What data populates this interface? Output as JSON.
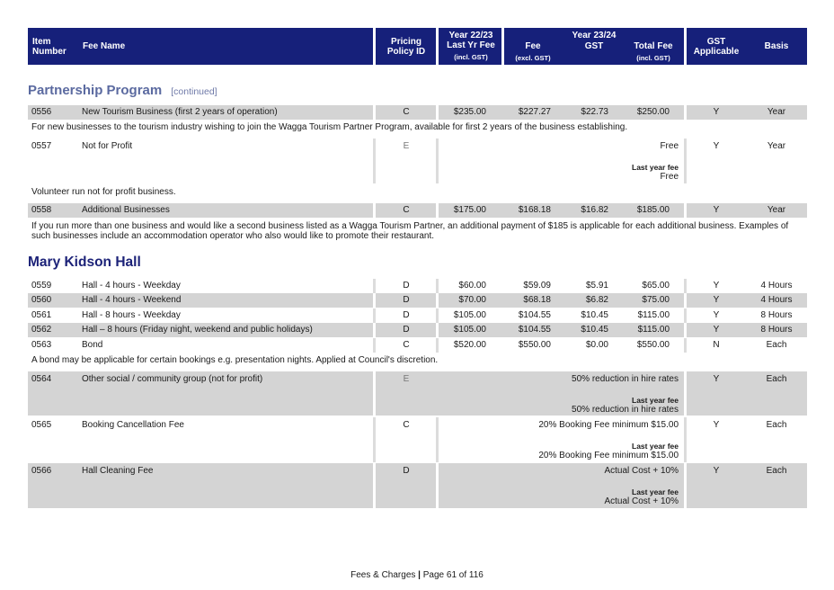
{
  "header": {
    "item_number": "Item Number",
    "fee_name": "Fee Name",
    "pricing_policy": "Pricing Policy ID",
    "year_prev_top": "Year 22/23",
    "year_prev_mid": "Last Yr Fee",
    "year_prev_small": "(incl. GST)",
    "year_curr": "Year 23/24",
    "fee": "Fee",
    "fee_small": "(excl. GST)",
    "gst": "GST",
    "total_fee": "Total Fee",
    "total_small": "(incl. GST)",
    "gst_applicable": "GST Applicable",
    "basis": "Basis"
  },
  "sections": {
    "partnership": {
      "title": "Partnership Program",
      "note": "[continued]"
    },
    "hall": {
      "title": "Mary Kidson Hall"
    }
  },
  "rows": {
    "r0556": {
      "item": "0556",
      "name": "New Tourism Business (first 2 years of operation)",
      "policy": "C",
      "last": "$235.00",
      "fee": "$227.27",
      "gst": "$22.73",
      "total": "$250.00",
      "gst_app": "Y",
      "basis": "Year",
      "desc": "For new businesses to the tourism industry wishing to join the Wagga Tourism Partner Program, available for first 2 years of the business establishing."
    },
    "r0557": {
      "item": "0557",
      "name": "Not for Profit",
      "policy": "E",
      "value": "Free",
      "last_label": "Last year fee",
      "last_value": "Free",
      "gst_app": "Y",
      "basis": "Year",
      "desc": "Volunteer run not for profit business."
    },
    "r0558": {
      "item": "0558",
      "name": "Additional Businesses",
      "policy": "C",
      "last": "$175.00",
      "fee": "$168.18",
      "gst": "$16.82",
      "total": "$185.00",
      "gst_app": "Y",
      "basis": "Year",
      "desc_line1": "If you run more than one business and would like a second business listed as a Wagga Tourism Partner, an additional payment of $185 is applicable for each additional business. Examples of",
      "desc_line2": "such businesses include an accommodation operator who also would like to promote their restaurant."
    },
    "r0559": {
      "item": "0559",
      "name": "Hall - 4 hours - Weekday",
      "policy": "D",
      "last": "$60.00",
      "fee": "$59.09",
      "gst": "$5.91",
      "total": "$65.00",
      "gst_app": "Y",
      "basis": "4 Hours"
    },
    "r0560": {
      "item": "0560",
      "name": "Hall - 4 hours - Weekend",
      "policy": "D",
      "last": "$70.00",
      "fee": "$68.18",
      "gst": "$6.82",
      "total": "$75.00",
      "gst_app": "Y",
      "basis": "4 Hours"
    },
    "r0561": {
      "item": "0561",
      "name": "Hall - 8 hours - Weekday",
      "policy": "D",
      "last": "$105.00",
      "fee": "$104.55",
      "gst": "$10.45",
      "total": "$115.00",
      "gst_app": "Y",
      "basis": "8 Hours"
    },
    "r0562": {
      "item": "0562",
      "name": "Hall – 8 hours (Friday night, weekend and public holidays)",
      "policy": "D",
      "last": "$105.00",
      "fee": "$104.55",
      "gst": "$10.45",
      "total": "$115.00",
      "gst_app": "Y",
      "basis": "8 Hours"
    },
    "r0563": {
      "item": "0563",
      "name": "Bond",
      "policy": "C",
      "last": "$520.00",
      "fee": "$550.00",
      "gst": "$0.00",
      "total": "$550.00",
      "gst_app": "N",
      "basis": "Each",
      "desc": "A bond may be applicable for certain bookings e.g. presentation nights. Applied at Council's discretion."
    },
    "r0564": {
      "item": "0564",
      "name": "Other social / community group (not for profit)",
      "policy": "E",
      "value": "50% reduction in hire rates",
      "last_label": "Last year fee",
      "last_value": "50% reduction in hire rates",
      "gst_app": "Y",
      "basis": "Each"
    },
    "r0565": {
      "item": "0565",
      "name": "Booking Cancellation Fee",
      "policy": "C",
      "value": "20% Booking Fee minimum $15.00",
      "last_label": "Last year fee",
      "last_value": "20% Booking Fee minimum $15.00",
      "gst_app": "Y",
      "basis": "Each"
    },
    "r0566": {
      "item": "0566",
      "name": "Hall Cleaning Fee",
      "policy": "D",
      "value": "Actual Cost + 10%",
      "last_label": "Last year fee",
      "last_value": "Actual Cost + 10%",
      "gst_app": "Y",
      "basis": "Each"
    }
  },
  "footer": {
    "left": "Fees & Charges",
    "divider": "|",
    "right": "Page 61 of 116"
  }
}
